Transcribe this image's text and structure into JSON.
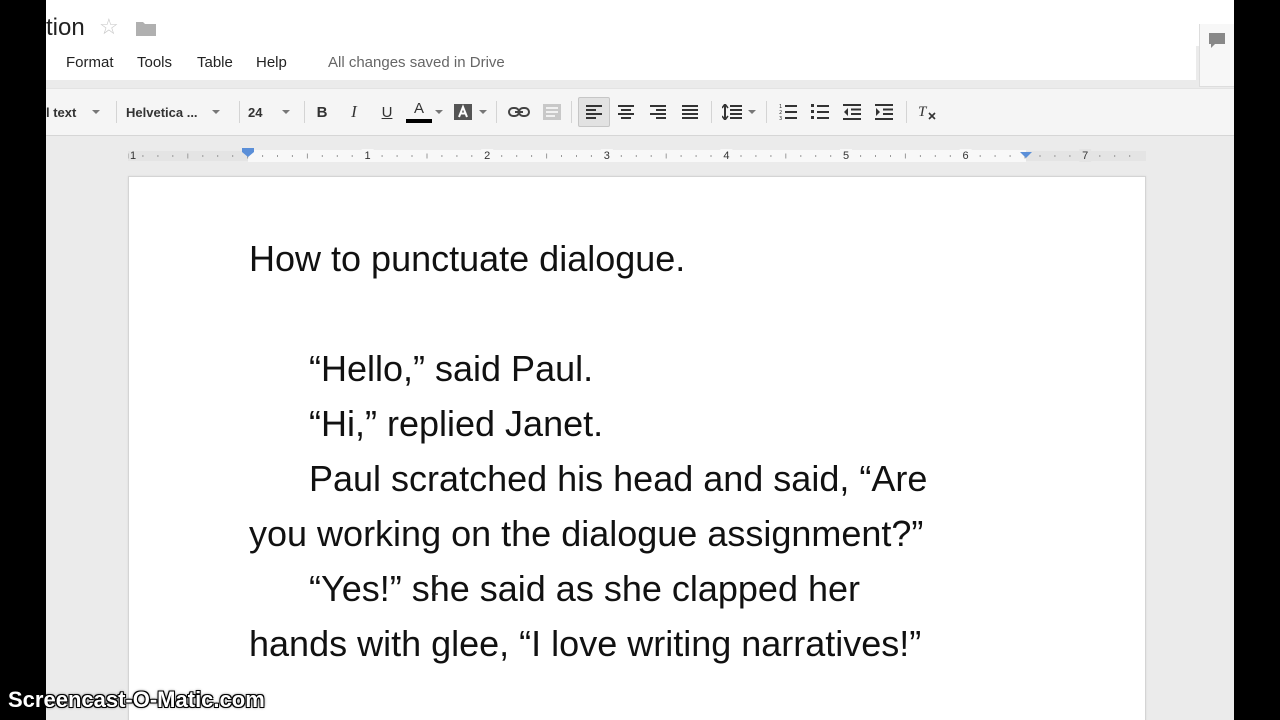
{
  "title_bar": {
    "doc_title": "tion",
    "star_icon": "star-icon",
    "folder_icon": "folder-icon",
    "comments_icon": "comment-icon"
  },
  "menu": {
    "items": [
      "Format",
      "Tools",
      "Table",
      "Help"
    ],
    "save_status": "All changes saved in Drive"
  },
  "toolbar": {
    "style_select": "l text",
    "font_select": "Helvetica ...",
    "size_select": "24",
    "bold": "B",
    "italic": "I",
    "underline": "U",
    "text_color": "A",
    "text_color_hex": "#000000",
    "active_align": "align-left"
  },
  "ruler": {
    "labels": [
      "1",
      "1",
      "2",
      "3",
      "4",
      "5",
      "6",
      "7"
    ]
  },
  "document": {
    "lines": [
      "How to punctuate dialogue.",
      "“Hello,” said Paul.",
      "“Hi,” replied Janet.",
      "Paul scratched his head and said, “Are",
      "you working on the dialogue assignment?”",
      "“Yes!” she said as she clapped her",
      "hands with glee, “I love writing narratives!”"
    ]
  },
  "watermark": "Screencast-O-Matic.com",
  "colors": {
    "accent_blue": "#5b8fd8",
    "text": "#111111",
    "toolbar_bg": "#f5f5f5"
  }
}
